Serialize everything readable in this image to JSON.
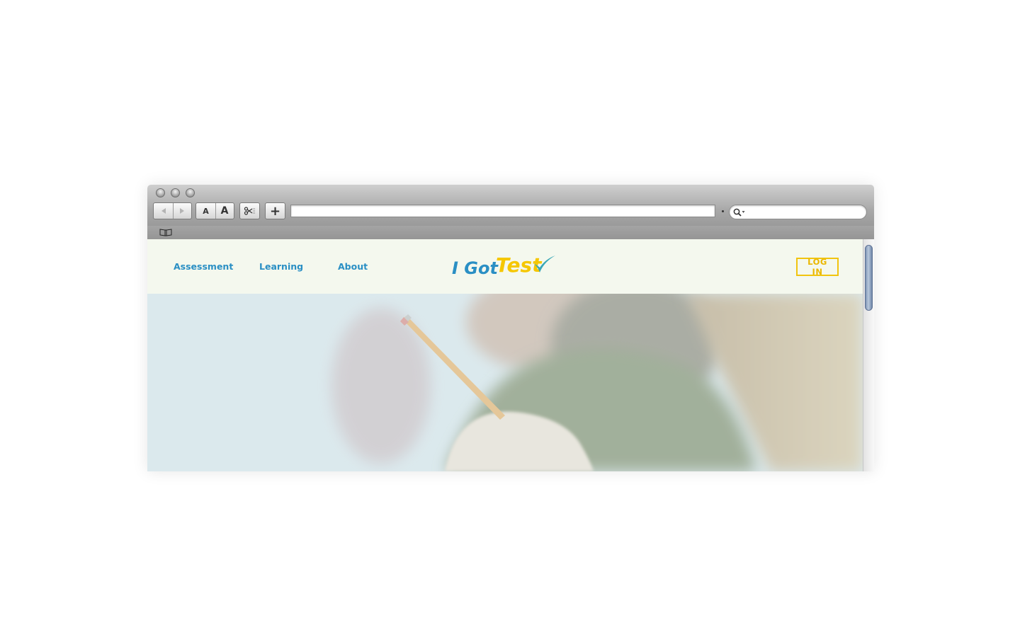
{
  "browser": {
    "toolbar": {
      "back_icon": "back-arrow-icon",
      "forward_icon": "forward-arrow-icon",
      "font_small_label": "A",
      "font_large_label": "A",
      "clip_icon": "scissors-icon",
      "add_label": "+",
      "address_value": "",
      "search_value": "",
      "bookmarks_icon": "open-book-icon"
    }
  },
  "site": {
    "nav": {
      "items": [
        {
          "label": "Assessment"
        },
        {
          "label": "Learning"
        },
        {
          "label": "About"
        }
      ]
    },
    "logo": {
      "part1": "I Got",
      "part2": "Test",
      "color_blue": "#2a8fc4",
      "color_yellow": "#f5c700",
      "color_check": "#3aa7b6"
    },
    "login_label": "LOG IN",
    "colors": {
      "header_bg": "#f4f8ee",
      "nav_link": "#2a8fc4",
      "login_border": "#f1c40f"
    }
  }
}
